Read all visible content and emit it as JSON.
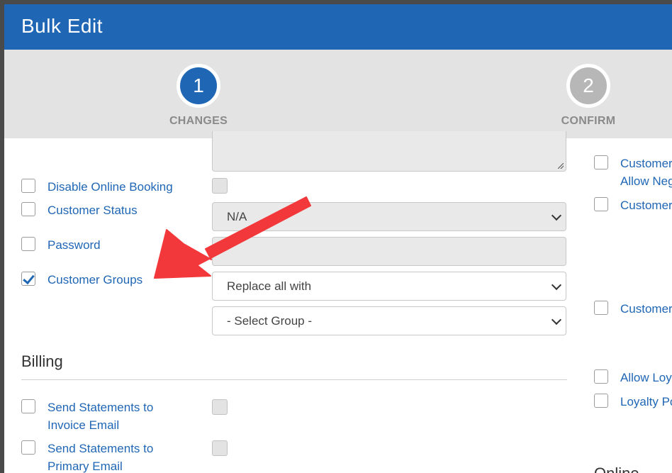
{
  "modal": {
    "title": "Bulk Edit"
  },
  "stepper": {
    "steps": [
      {
        "number": "1",
        "label": "CHANGES",
        "active": true
      },
      {
        "number": "2",
        "label": "CONFIRM",
        "active": false
      }
    ]
  },
  "left": {
    "fields": [
      {
        "label": "Disable Online Booking",
        "checked": false
      },
      {
        "label": "Customer Status",
        "checked": false,
        "select_value": "N/A"
      },
      {
        "label": "Password",
        "checked": false
      },
      {
        "label": "Customer Groups",
        "checked": true,
        "mode_value": "Replace all with",
        "group_value": "- Select Group -"
      }
    ],
    "billing": {
      "title": "Billing",
      "fields": [
        {
          "label_line1": "Send Statements to",
          "label_line2": "Invoice Email",
          "checked": false
        },
        {
          "label_line1": "Send Statements to",
          "label_line2": "Primary Email",
          "checked": false
        }
      ]
    }
  },
  "right": {
    "fields": [
      {
        "label_line1": "Customer",
        "label_line2": "Allow Neg"
      },
      {
        "label": "Customer"
      },
      {
        "label": "Customer"
      },
      {
        "label": "Allow Loy"
      },
      {
        "label": "Loyalty Po"
      }
    ],
    "partial_heading": "Online"
  },
  "colors": {
    "brand": "#1f66b5",
    "annotation_arrow": "#f2383a"
  }
}
